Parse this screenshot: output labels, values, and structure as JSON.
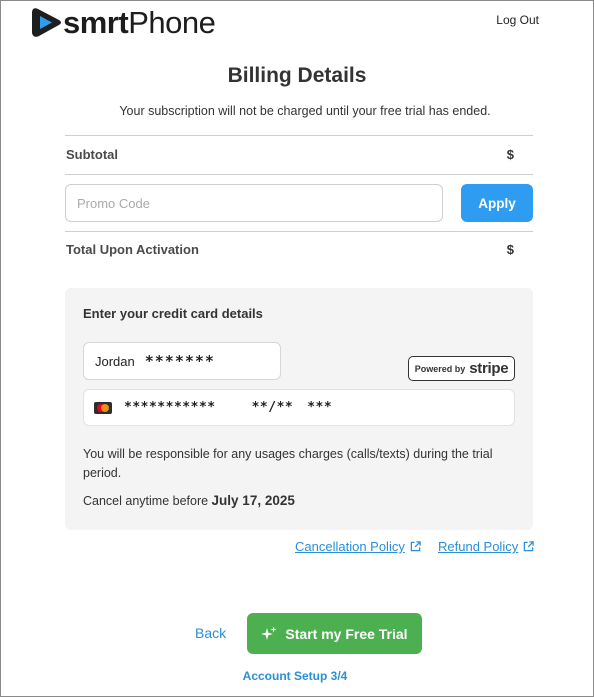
{
  "brand": {
    "name_bold": "smrt",
    "name_light": "Phone",
    "accent": "#2e9cf0",
    "cta_color": "#4caf50"
  },
  "header": {
    "logout_label": "Log Out"
  },
  "page": {
    "title": "Billing Details",
    "subtitle": "Your subscription will not be charged until your free trial has ended."
  },
  "summary": {
    "subtotal_label": "Subtotal",
    "subtotal_value": "$",
    "total_label": "Total Upon Activation",
    "total_value": "$"
  },
  "promo": {
    "placeholder": "Promo Code",
    "value": "",
    "apply_label": "Apply"
  },
  "card_section": {
    "title": "Enter your credit card details",
    "name_first": "Jordan",
    "name_masked": "*******",
    "stripe_powered": "Powered by",
    "stripe_word": "stripe",
    "card_brand_icon": "mastercard-icon",
    "card_number_masked": "***********",
    "expiry_masked": "**/**",
    "cvc_masked": "***",
    "usage_note": "You will be responsible for any usages charges (calls/texts) during the trial period.",
    "cancel_prefix": "Cancel anytime before ",
    "cancel_date": "July 17, 2025"
  },
  "links": {
    "cancellation_policy": "Cancellation Policy",
    "refund_policy": "Refund Policy"
  },
  "footer": {
    "back_label": "Back",
    "start_label": "Start my Free Trial",
    "step_label": "Account Setup 3/4"
  }
}
